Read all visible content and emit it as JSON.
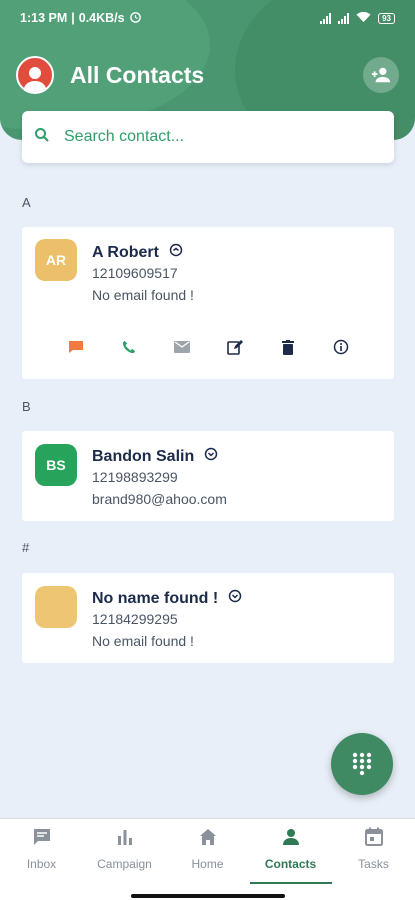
{
  "status_bar": {
    "time": "1:13 PM",
    "speed": "0.4KB/s",
    "battery": "93"
  },
  "header": {
    "title": "All Contacts"
  },
  "search": {
    "placeholder": "Search contact..."
  },
  "sections": [
    {
      "letter": "A"
    },
    {
      "letter": "B"
    },
    {
      "letter": "#"
    }
  ],
  "contacts": [
    {
      "initials": "AR",
      "name": "A Robert",
      "phone": "12109609517",
      "email": "No email found !",
      "badge_color": "#ecc06a"
    },
    {
      "initials": "BS",
      "name": "Bandon Salin",
      "phone": "12198893299",
      "email": "brand980@ahoo.com",
      "badge_color": "#28a35c"
    },
    {
      "initials": "",
      "name": "No name found !",
      "phone": "12184299295",
      "email": "No email found !",
      "badge_color": "#edc573"
    }
  ],
  "bottom_nav": [
    {
      "label": "Inbox",
      "icon": "chat-icon"
    },
    {
      "label": "Campaign",
      "icon": "bar-chart-icon"
    },
    {
      "label": "Home",
      "icon": "home-icon"
    },
    {
      "label": "Contacts",
      "icon": "person-icon",
      "active": true
    },
    {
      "label": "Tasks",
      "icon": "calendar-icon"
    }
  ],
  "colors": {
    "primary": "#3f8a63",
    "accent": "#2f9f6a",
    "background": "#e8eff8"
  }
}
